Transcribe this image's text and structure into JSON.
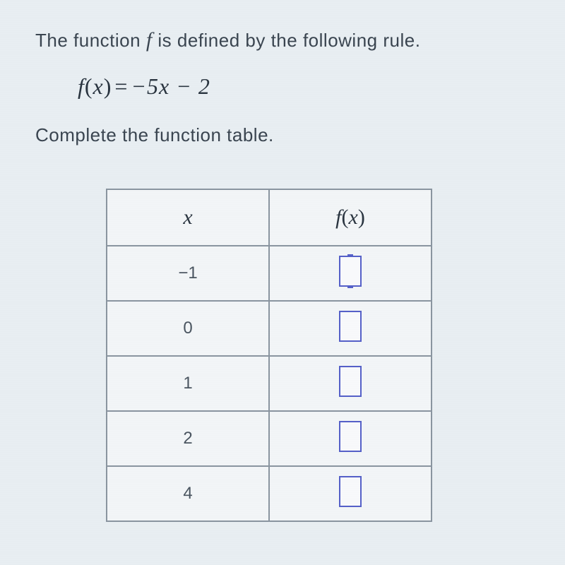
{
  "question": {
    "intro_before": "The function ",
    "function_name": "f",
    "intro_after": " is defined by the following rule.",
    "formula_lhs_f": "f",
    "formula_lhs_x": "x",
    "formula_rhs": "−5x − 2",
    "instruction": "Complete the function table."
  },
  "table": {
    "header_x": "x",
    "header_fx_f": "f",
    "header_fx_x": "x",
    "rows": [
      {
        "x": "−1",
        "active": true
      },
      {
        "x": "0",
        "active": false
      },
      {
        "x": "1",
        "active": false
      },
      {
        "x": "2",
        "active": false
      },
      {
        "x": "4",
        "active": false
      }
    ]
  }
}
